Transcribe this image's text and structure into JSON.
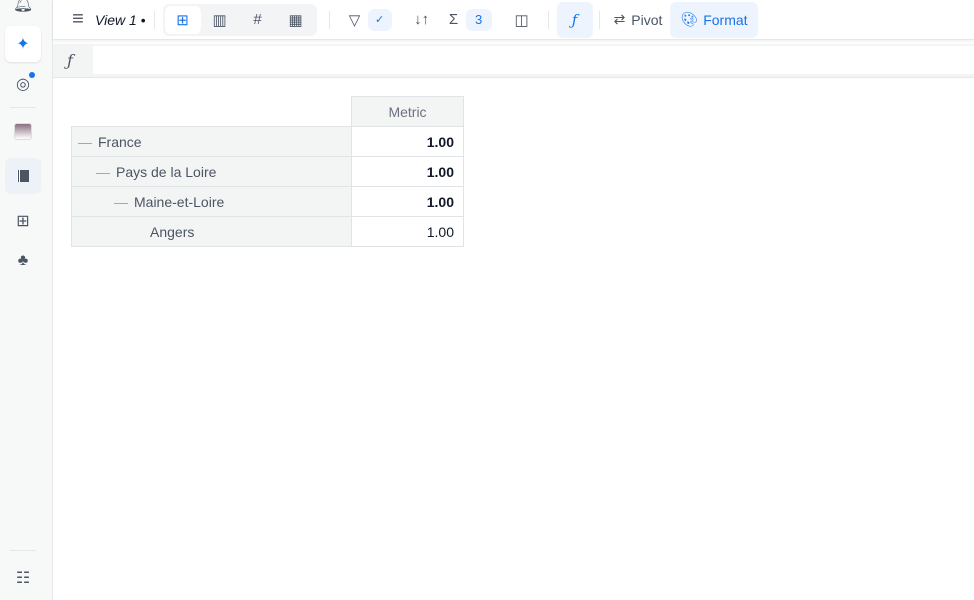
{
  "toolbar": {
    "view_title": "View 1 •",
    "filter_check": "✓",
    "aggregations_count": "3",
    "pivot_label": "Pivot",
    "format_label": "Format"
  },
  "formula": {
    "fx": "ƒ",
    "value": ""
  },
  "table": {
    "header": "Metric",
    "rows": [
      {
        "label": "France",
        "value": "1.00",
        "level": 0,
        "collapsible": true
      },
      {
        "label": "Pays de la Loire",
        "value": "1.00",
        "level": 1,
        "collapsible": true
      },
      {
        "label": "Maine-et-Loire",
        "value": "1.00",
        "level": 2,
        "collapsible": true
      },
      {
        "label": "Angers",
        "value": "1.00",
        "level": 3,
        "collapsible": false
      }
    ]
  },
  "colors": {
    "accent": "#1a73e8",
    "accent_bg": "#eef4fd"
  }
}
